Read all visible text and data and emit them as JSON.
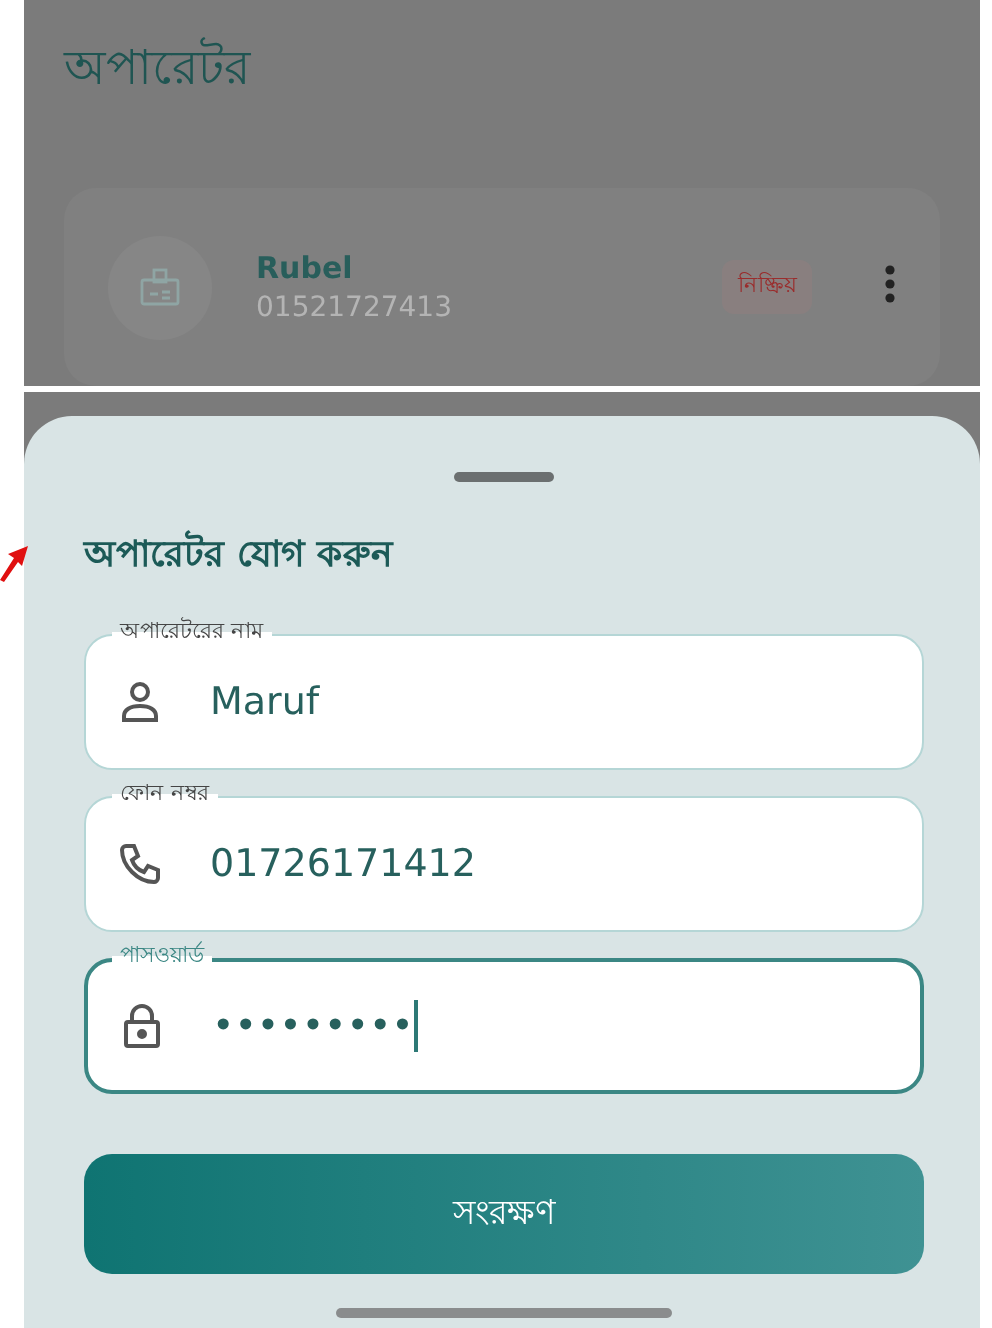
{
  "background": {
    "title": "অপারেটর",
    "operators": [
      {
        "name": "Rubel",
        "phone": "01521727413",
        "status": "নিষ্ক্রিয়"
      }
    ]
  },
  "sheet": {
    "title": "অপারেটর যোগ করুন",
    "fields": [
      {
        "kind": "person",
        "label": "অপারেটরের নাম",
        "value": "Maruf",
        "focused": false
      },
      {
        "kind": "phone",
        "label": "ফোন নম্বর",
        "value": "01726171412",
        "focused": false
      },
      {
        "kind": "lock",
        "label": "পাসওয়ার্ড",
        "value": "•••••••••",
        "focused": true
      }
    ],
    "save_button": "সংরক্ষণ"
  }
}
